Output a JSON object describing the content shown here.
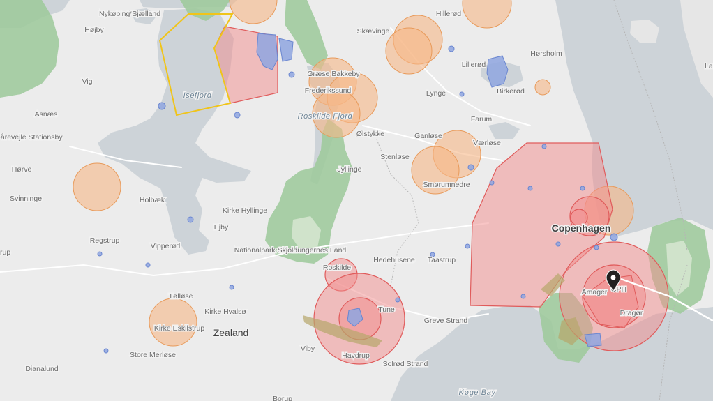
{
  "map": {
    "water_labels": [
      "Isefjord",
      "Roskilde Fjord",
      "Køge Bay"
    ],
    "region_labels": [
      "Zealand",
      "Copenhagen"
    ],
    "place_labels": [
      "Nykøbing Sjælland",
      "Højby",
      "Vig",
      "Asnæs",
      "Fårevejle Stationsby",
      "Hørve",
      "Svinninge",
      "Holbæk",
      "Regstrup",
      "Vipperød",
      "Kirke Hyllinge",
      "Ejby",
      "Tølløse",
      "Kirke Hvalsø",
      "Kirke Eskilstrup",
      "Store Merløse",
      "Dianalund",
      "Viby",
      "Havdrup",
      "Tune",
      "Roskilde",
      "Hedehusene",
      "Taastrup",
      "Greve Strand",
      "Solrød Strand",
      "Jyllinge",
      "Stenløse",
      "Smørumnedre",
      "Ølstykke",
      "Ganløse",
      "Værløse",
      "Farum",
      "Lynge",
      "Lillerød",
      "Birkerød",
      "Hillerød",
      "Skævinge",
      "Hørsholm",
      "Frederikssund",
      "Græse Bakkeby",
      "Nationalpark Skjoldungernes Land",
      "Amager",
      "Dragør",
      "Landskrona",
      "rup",
      "CPH",
      "Borup"
    ],
    "marker": {
      "name": "map-pin",
      "label": "CPH"
    },
    "colors": {
      "land": "#ececec",
      "water": "#cdd3d8",
      "park": "#9cc99a",
      "restricted_zone": "#f28b8b",
      "caution_zone": "#f6b787",
      "urban_zone": "#8fa6e0",
      "tma_outline": "#f0c419"
    }
  }
}
